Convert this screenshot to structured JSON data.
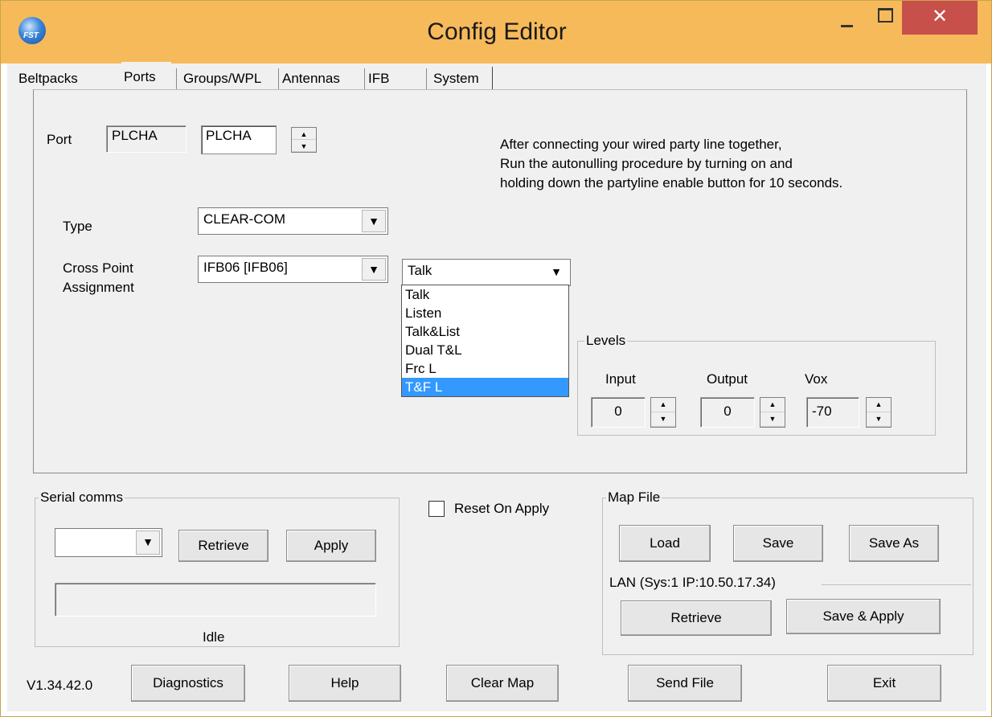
{
  "window": {
    "title": "Config Editor",
    "close_glyph": "✕"
  },
  "tabs": [
    "Beltpacks",
    "Ports",
    "Groups/WPL",
    "Antennas",
    "IFB",
    "System"
  ],
  "ports": {
    "port_label": "Port",
    "port_readonly": "PLCHA",
    "port_edit": "PLCHA",
    "info_lines": [
      "After connecting your wired party line together,",
      "Run the autonulling procedure by turning on and",
      "holding down the partyline enable button for 10 seconds."
    ],
    "type_label": "Type",
    "type_value": "CLEAR-COM",
    "crosspoint_label_1": "Cross Point",
    "crosspoint_label_2": "Assignment",
    "crosspoint_value": "IFB06  [IFB06]",
    "mode_value": "Talk",
    "mode_options": [
      "Talk",
      "Listen",
      "Talk&List",
      "Dual T&L",
      "Frc L",
      "T&F L"
    ],
    "mode_highlighted": "T&F L",
    "levels": {
      "title": "Levels",
      "input_label": "Input",
      "input_value": "0",
      "output_label": "Output",
      "output_value": "0",
      "vox_label": "Vox",
      "vox_value": "-70"
    }
  },
  "serial": {
    "title": "Serial comms",
    "retrieve": "Retrieve",
    "apply": "Apply",
    "status": "Idle"
  },
  "reset_on_apply": "Reset On Apply",
  "mapfile": {
    "title": "Map File",
    "load": "Load",
    "save": "Save",
    "save_as": "Save As",
    "lan_title": "LAN  (Sys:1 IP:10.50.17.34)",
    "lan_retrieve": "Retrieve",
    "lan_save_apply": "Save & Apply"
  },
  "bottom": {
    "version": "V1.34.42.0",
    "diagnostics": "Diagnostics",
    "help": "Help",
    "clear_map": "Clear Map",
    "send_file": "Send File",
    "exit": "Exit"
  },
  "colors": {
    "titlebar": "#f7ba5a",
    "close_button": "#c7504a",
    "selection": "#3399ff"
  }
}
